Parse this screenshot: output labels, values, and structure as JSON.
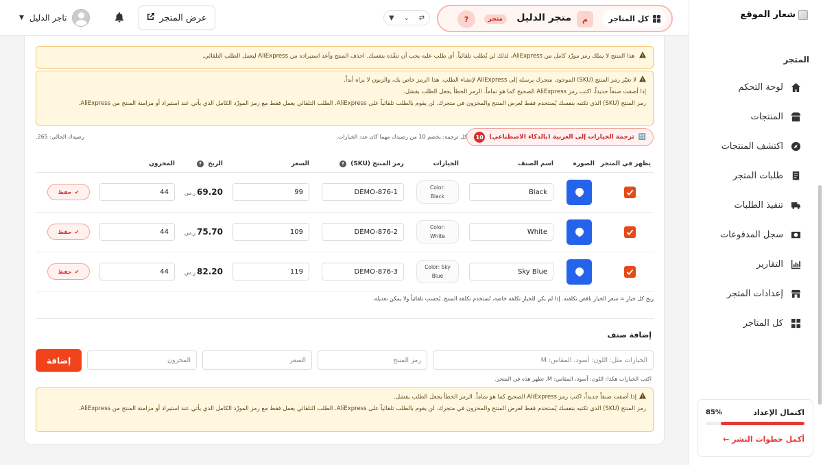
{
  "sidebar": {
    "logo": "شعار الموقع",
    "section_title": "المتجر",
    "items": [
      {
        "label": "لوحة التحكم",
        "icon": "home-icon"
      },
      {
        "label": "المنتجات",
        "icon": "box-icon"
      },
      {
        "label": "اكتشف المنتجات",
        "icon": "compass-icon"
      },
      {
        "label": "طلبات المتجر",
        "icon": "receipt-icon"
      },
      {
        "label": "تنفيذ الطلبات",
        "icon": "truck-icon"
      },
      {
        "label": "سجل المدفوعات",
        "icon": "money-icon"
      },
      {
        "label": "التقارير",
        "icon": "chart-icon"
      },
      {
        "label": "إعدادات المتجر",
        "icon": "store-icon"
      },
      {
        "label": "كل المتاجر",
        "icon": "grid-icon"
      }
    ],
    "progress": {
      "title": "اكتمال الإعداد",
      "percent": "85%",
      "value": 0.85,
      "link": "أكمل خطوات النشر ←"
    }
  },
  "topbar": {
    "all_stores": "كل المتاجر",
    "store_initial": "م",
    "store_name": "متجر الدليل",
    "store_badge": "متجر",
    "help": "?",
    "view_store": "عرض المتجر",
    "user_name": "تاجر الدليل"
  },
  "alerts": {
    "a1": "هذا المنتج لا يملك رمز موزّد كامل من AliExpress، لذلك لن يُطلب تلقائياً. أي طلب عليه يجب أن تنفّذه بنفسك. احذف المنتج وأعد استيراده من AliExpress ليعمل الطلب التلقائي.",
    "a2_l1": "لا تغيّر رمز المنتج (SKU) الموجود. متجرك يرسله إلى AliExpress لإنشاء الطلب. هذا الرمز خاص بك، والزبون لا يراه أبداً.",
    "a2_l2": "إذا أضفت صنفاً جديداً، اكتب رمز AliExpress الصحيح كما هو تماماً. الرمز الخطأ يجعل الطلب يفشل.",
    "a2_l3": "رمز المنتج (SKU) الذي تكتبه بنفسك يُستخدم فقط لعرض المنتج والمخزون في متجرك. لن يقوم بالطلب تلقائياً على AliExpress. الطلب التلقائي يعمل فقط مع رمز الموزّد الكامل الذي يأتي عند استيراد أو مزامنة المنتج من AliExpress.",
    "a3_l1": "إذا أضفت صنفاً جديداً، اكتب رمز AliExpress الصحيح كما هو تماماً. الرمز الخطأ يجعل الطلب يفشل.",
    "a3_l2": "رمز المنتج (SKU) الذي تكتبه بنفسك يُستخدم فقط لعرض المنتج والمخزون في متجرك. لن يقوم بالطلب تلقائياً على AliExpress. الطلب التلقائي يعمل فقط مع رمز الموزّد الكامل الذي يأتي عند استيراد أو مزامنة المنتج من AliExpress."
  },
  "ai": {
    "button": "ترجمة الخيارات إلى العربية (بالذكاء الاصطناعي)",
    "count": "10",
    "note": "كل ترجمة: يخصم 10 من رصيدك مهما كان عدد الخيارات.",
    "balance": "رصيدك الحالي: 265."
  },
  "table": {
    "headers": {
      "show": "يظهر في المتجر",
      "image": "الصورة",
      "name": "اسم الصنف",
      "options": "الخيارات",
      "sku": "رمز المنتج (SKU)",
      "price": "السعر",
      "profit": "الربح",
      "stock": "المخزون"
    },
    "rows": [
      {
        "name": "Black",
        "option": "Color: Black",
        "sku": "DEMO-876-1",
        "price": "99",
        "profit": "69.20",
        "currency": "ر.س",
        "stock": "44",
        "save": "حفظ"
      },
      {
        "name": "White",
        "option": "Color: White",
        "sku": "DEMO-876-2",
        "price": "109",
        "profit": "75.70",
        "currency": "ر.س",
        "stock": "44",
        "save": "حفظ"
      },
      {
        "name": "Sky Blue",
        "option": "Color: Sky Blue",
        "sku": "DEMO-876-3",
        "price": "119",
        "profit": "82.20",
        "currency": "ر.س",
        "stock": "44",
        "save": "حفظ"
      }
    ]
  },
  "profit_note": "ربح كل خيار = سعر الخيار ناقص تكلفته. إذا لم يكن للخيار تكلفة خاصة، تُستخدم تكلفة المنتج. يُحسب تلقائياً ولا يمكن تعديله.",
  "add_variant": {
    "title": "إضافة صنف",
    "options_ph": "الخيارات مثل: اللون: أسود، المقاس: M",
    "sku_ph": "رمز المنتج",
    "price_ph": "السعر",
    "stock_ph": "المخزون",
    "button": "إضافة",
    "hint": "اكتب الخيارات هكذا: اللون: أسود، المقاس: M. تظهر هذه في المتجر."
  }
}
